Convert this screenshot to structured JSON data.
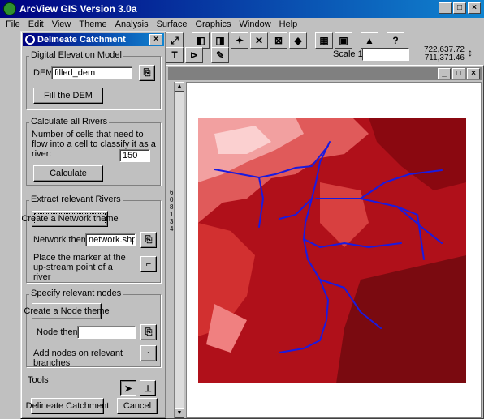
{
  "app": {
    "title": "ArcView GIS Version 3.0a",
    "window_buttons": [
      "_",
      "□",
      "×"
    ]
  },
  "menu": [
    "File",
    "Edit",
    "View",
    "Theme",
    "Analysis",
    "Surface",
    "Graphics",
    "Window",
    "Help"
  ],
  "toolbar": {
    "scale_label": "Scale 1:",
    "scale_value": "",
    "coord_x": "722,637.72",
    "coord_y": "711,371.46"
  },
  "view": {
    "window_buttons": [
      "_",
      "□",
      "×"
    ],
    "side_label": "60813 4"
  },
  "dialog": {
    "title": "Delineate Catchment",
    "close": "×",
    "dem_group": {
      "label": "Digital Elevation Model",
      "dem_label": "DEM",
      "dem_value": "filled_dem",
      "fill_button": "Fill the DEM"
    },
    "rivers_group": {
      "label": "Calculate all Rivers",
      "description": "Number of cells that need to flow into a cell to classify it as a river:",
      "cells_value": "150",
      "calculate_button": "Calculate"
    },
    "extract_group": {
      "label": "Extract relevant Rivers",
      "network_button": "Create a Network theme",
      "network_label": "Network theme",
      "network_value": "network.shp",
      "marker_text": "Place the marker at the up-stream point of a river"
    },
    "nodes_group": {
      "label": "Specify relevant nodes",
      "node_button": "Create a Node theme",
      "node_label": "Node theme",
      "node_value": "",
      "add_nodes_text": "Add nodes on relevant branches"
    },
    "tools_group": {
      "label": "Tools"
    },
    "delineate_button": "Delineate Catchment",
    "cancel_button": "Cancel"
  }
}
